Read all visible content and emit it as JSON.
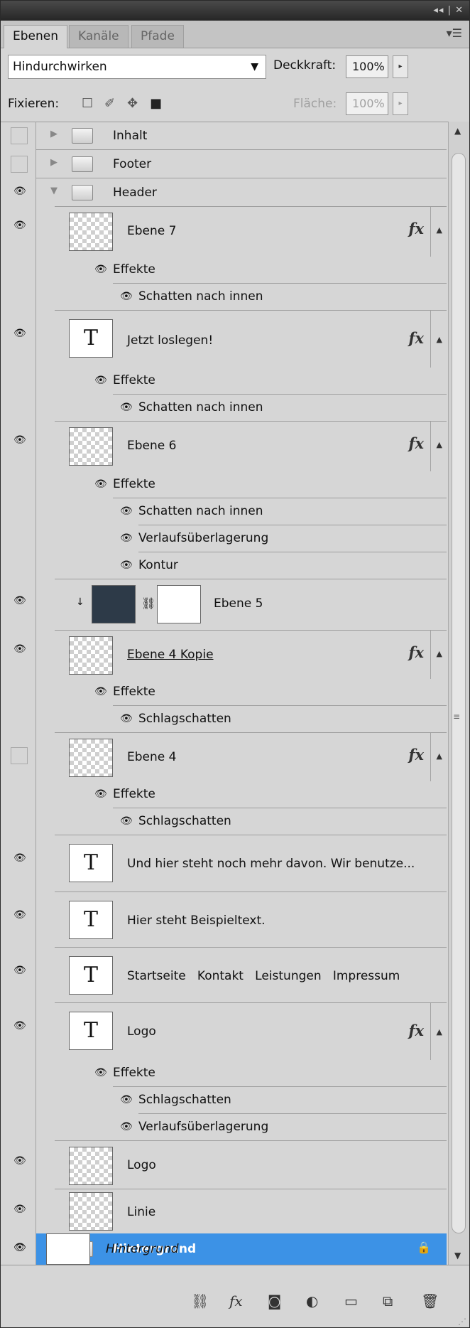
{
  "tabs": [
    "Ebenen",
    "Kanäle",
    "Pfade"
  ],
  "window_controls": "◂◂ | ✕",
  "blend_mode": "Hindurchwirken",
  "opacity_label": "Deckkraft:",
  "opacity_value": "100%",
  "lock_label": "Fixieren:",
  "fill_label": "Fläche:",
  "fill_value": "100%",
  "layers": {
    "inhalt": "Inhalt",
    "footer": "Footer",
    "header": "Header",
    "ebene7": "Ebene 7",
    "jetzt": "Jetzt loslegen!",
    "ebene6": "Ebene 6",
    "ebene5": "Ebene 5",
    "ebene4kopie": "Ebene 4 Kopie",
    "ebene4": "Ebene 4",
    "und_hier": "Und hier steht noch mehr davon. Wir benutze...",
    "hier_steht": "Hier steht Beispieltext.",
    "nav": "Startseite   Kontakt   Leistungen   Impressum",
    "logo_text": "Logo",
    "logo": "Logo",
    "linie": "Linie",
    "hintergrund_group": "Hintergrund",
    "hintergrund": "Hintergrund"
  },
  "effects": {
    "effekte": "Effekte",
    "schatten_innen": "Schatten nach innen",
    "verlauf": "Verlaufsüberlagerung",
    "kontur": "Kontur",
    "schlagschatten": "Schlagschatten"
  },
  "fx_label": "fx"
}
